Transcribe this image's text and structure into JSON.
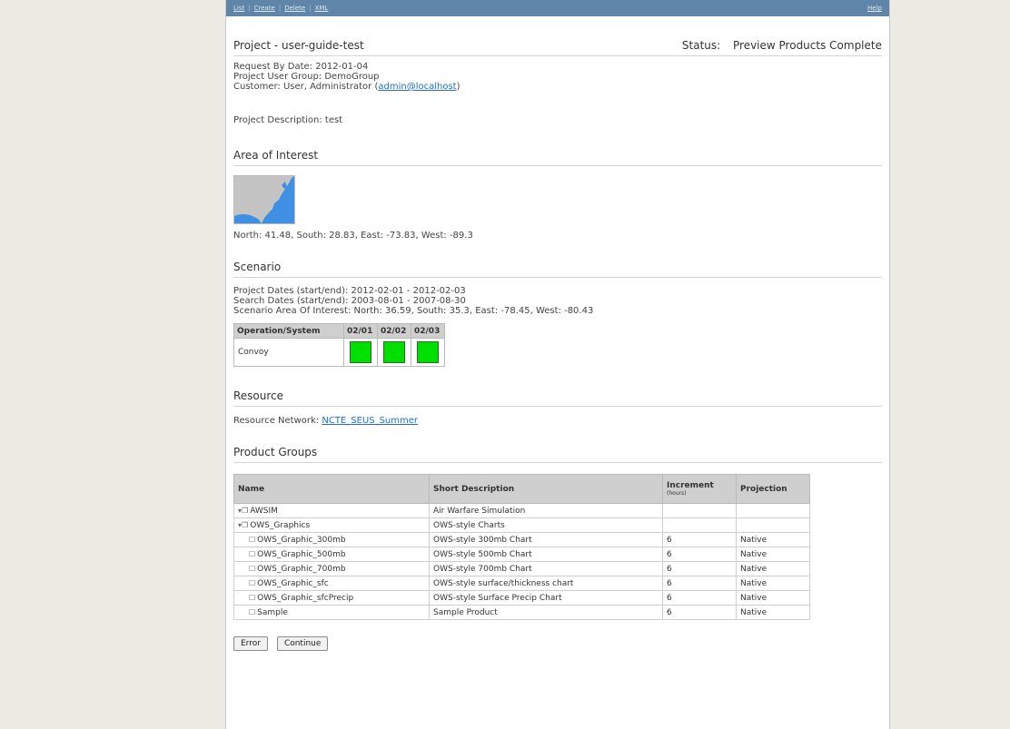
{
  "topbar": {
    "links": [
      "List",
      "Create",
      "Delete",
      "XML"
    ],
    "help": "Help"
  },
  "project": {
    "title": "Project - user-guide-test",
    "status_label": "Status:",
    "status_value": "Preview Products Complete",
    "request_by": "Request By Date: 2012-01-04",
    "user_group": "Project User Group: DemoGroup",
    "customer_prefix": "Customer: User, Administrator (",
    "customer_email": "admin@localhost",
    "customer_suffix": ")",
    "description": "Project Description: test"
  },
  "area_of_interest": {
    "heading": "Area of Interest",
    "coords": "North: 41.48, South: 28.83, East: -73.83, West: -89.3"
  },
  "scenario": {
    "heading": "Scenario",
    "project_dates": "Project Dates (start/end): 2012-02-01 - 2012-02-03",
    "search_dates": "Search Dates (start/end): 2003-08-01 - 2007-08-30",
    "aoi": "Scenario Area Of Interest: North: 36.59, South: 35.3, East: -78.45, West: -80.43",
    "table": {
      "headers": [
        "Operation/System",
        "02/01",
        "02/02",
        "02/03"
      ],
      "row_label": "Convoy",
      "status_color": "#00e000"
    }
  },
  "resource": {
    "heading": "Resource",
    "label": "Resource Network: ",
    "network": "NCTE_SEUS_Summer"
  },
  "product_groups": {
    "heading": "Product Groups",
    "headers": {
      "name": "Name",
      "short": "Short Description",
      "increment": "Increment",
      "increment_unit": "(hours)",
      "projection": "Projection"
    },
    "rows": [
      {
        "name": "AWSIM",
        "desc": "Air Warfare Simulation",
        "inc": "",
        "proj": "",
        "kind": "group",
        "indent": 0
      },
      {
        "name": "OWS_Graphics",
        "desc": "OWS-style Charts",
        "inc": "",
        "proj": "",
        "kind": "group",
        "indent": 0
      },
      {
        "name": "OWS_Graphic_300mb",
        "desc": "OWS-style 300mb Chart",
        "inc": "6",
        "proj": "Native",
        "kind": "file",
        "indent": 1
      },
      {
        "name": "OWS_Graphic_500mb",
        "desc": "OWS-style 500mb Chart",
        "inc": "6",
        "proj": "Native",
        "kind": "file",
        "indent": 1
      },
      {
        "name": "OWS_Graphic_700mb",
        "desc": "OWS-style 700mb Chart",
        "inc": "6",
        "proj": "Native",
        "kind": "file",
        "indent": 1
      },
      {
        "name": "OWS_Graphic_sfc",
        "desc": "OWS-style surface/thickness chart",
        "inc": "6",
        "proj": "Native",
        "kind": "file",
        "indent": 1
      },
      {
        "name": "OWS_Graphic_sfcPrecip",
        "desc": "OWS-style Surface Precip Chart",
        "inc": "6",
        "proj": "Native",
        "kind": "file",
        "indent": 1
      },
      {
        "name": "Sample",
        "desc": "Sample Product",
        "inc": "6",
        "proj": "Native",
        "kind": "file",
        "indent": 1
      }
    ]
  },
  "buttons": {
    "error": "Error",
    "continue": "Continue"
  }
}
